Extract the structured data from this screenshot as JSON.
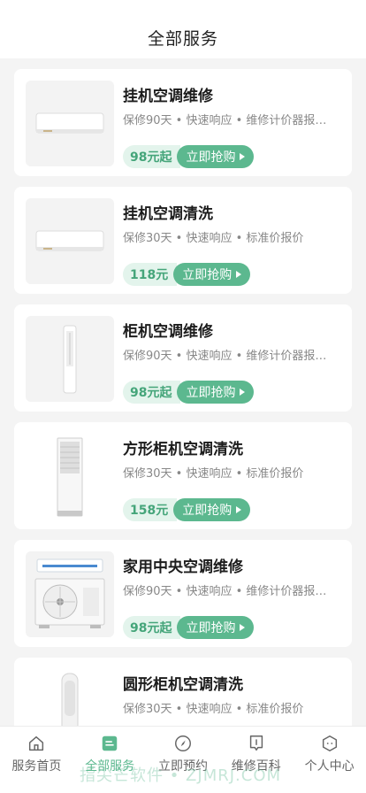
{
  "header": {
    "title": "全部服务"
  },
  "buy_label": "立即抢购",
  "services": [
    {
      "title": "挂机空调维修",
      "desc": "保修90天 • 快速响应 • 维修计价器报价…",
      "price": "98元起",
      "image": "wall-ac"
    },
    {
      "title": "挂机空调清洗",
      "desc": "保修30天 • 快速响应 • 标准价报价",
      "price": "118元",
      "image": "wall-ac"
    },
    {
      "title": "柜机空调维修",
      "desc": "保修90天 • 快速响应 • 维修计价器报价…",
      "price": "98元起",
      "image": "tower-ac"
    },
    {
      "title": "方形柜机空调清洗",
      "desc": "保修30天 • 快速响应 • 标准价报价",
      "price": "158元",
      "image": "floor-ac"
    },
    {
      "title": "家用中央空调维修",
      "desc": "保修90天 • 快速响应 • 维修计价器报价…",
      "price": "98元起",
      "image": "outdoor-unit"
    },
    {
      "title": "圆形柜机空调清洗",
      "desc": "保修30天 • 快速响应 • 标准价报价",
      "price": "",
      "image": "round-ac"
    }
  ],
  "tabbar": [
    {
      "label": "服务首页",
      "icon": "home-icon"
    },
    {
      "label": "全部服务",
      "icon": "list-icon"
    },
    {
      "label": "立即预约",
      "icon": "compass-icon"
    },
    {
      "label": "维修百科",
      "icon": "book-icon"
    },
    {
      "label": "个人中心",
      "icon": "user-icon"
    }
  ],
  "watermark": "指尖芒软件 • ZJMRJ.COM",
  "colors": {
    "accent": "#5cb88f",
    "accent_light": "#e3f4ec",
    "background": "#f4f4f4"
  }
}
